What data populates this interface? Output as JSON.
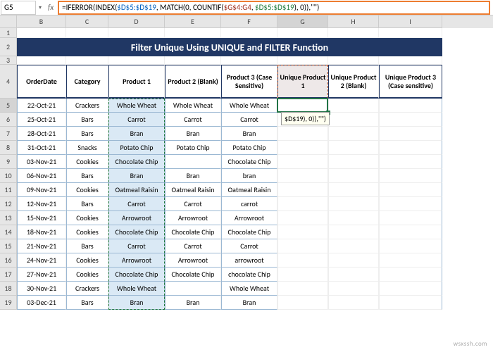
{
  "namebox": "G5",
  "fx": "fx",
  "formula_parts": {
    "p1": "=IFERROR(INDEX(",
    "p2": "$D$5:$D$19",
    "p3": ", MATCH(0, COUNTIF(",
    "p4": "$G$4:G4",
    "p5": ", ",
    "p6": "$D$5:$D$19",
    "p7": "), 0)),",
    "p8": "\"\"",
    "p9": ")"
  },
  "cols": [
    "B",
    "C",
    "D",
    "E",
    "F",
    "G",
    "H",
    "I"
  ],
  "title": "Filter Unique Using UNIQUE and FILTER Function",
  "headers": {
    "B": "OrderDate",
    "C": "Category",
    "D": "Product 1",
    "E": "Product 2 (Blank)",
    "F": "Product 3 (Case Sensitive)",
    "G": "Unique Product 1",
    "H": "Unique Product 2 (Blank)",
    "I": "Unique Product 3 (Case sensitive)"
  },
  "tooltip": "$D$19), 0)),\"\")",
  "rows": [
    {
      "n": 5,
      "B": "22-Oct-21",
      "C": "Crackers",
      "D": "Whole Wheat",
      "E": "Whole Wheat",
      "F": "Whole Wheat"
    },
    {
      "n": 6,
      "B": "25-Oct-21",
      "C": "Bars",
      "D": "Carrot",
      "E": "Carrot",
      "F": "Carrot"
    },
    {
      "n": 7,
      "B": "28-Oct-21",
      "C": "Bars",
      "D": "Bran",
      "E": "Bran",
      "F": "Bran"
    },
    {
      "n": 8,
      "B": "31-Oct-21",
      "C": "Snacks",
      "D": "Potato Chip",
      "E": "Potato Chip",
      "F": "Potato Chip"
    },
    {
      "n": 9,
      "B": "03-Nov-21",
      "C": "Cookies",
      "D": "Chocolate Chip",
      "E": "",
      "F": "Chocolate Chip"
    },
    {
      "n": 10,
      "B": "06-Nov-21",
      "C": "Bars",
      "D": "Bran",
      "E": "Bran",
      "F": "bran"
    },
    {
      "n": 11,
      "B": "09-Nov-21",
      "C": "Cookies",
      "D": "Oatmeal Raisin",
      "E": "Oatmeal Raisin",
      "F": "Oatmeal Raisin"
    },
    {
      "n": 12,
      "B": "12-Nov-21",
      "C": "Bars",
      "D": "Carrot",
      "E": "Carrot",
      "F": "carrot"
    },
    {
      "n": 13,
      "B": "15-Nov-21",
      "C": "Cookies",
      "D": "Arrowroot",
      "E": "Arrowroot",
      "F": "Arrowroot"
    },
    {
      "n": 14,
      "B": "18-Nov-21",
      "C": "Cookies",
      "D": "Chocolate Chip",
      "E": "Chocolate Chip",
      "F": "Chocolate Chip"
    },
    {
      "n": 15,
      "B": "21-Nov-21",
      "C": "Bars",
      "D": "Carrot",
      "E": "Carrot",
      "F": "Carrot"
    },
    {
      "n": 16,
      "B": "24-Nov-21",
      "C": "Cookies",
      "D": "Arrowroot",
      "E": "Arrowroot",
      "F": "arrowroot"
    },
    {
      "n": 17,
      "B": "27-Nov-21",
      "C": "Cookies",
      "D": "Chocolate Chip",
      "E": "Chocolate Chip",
      "F": "chocolate Chip"
    },
    {
      "n": 18,
      "B": "30-Nov-21",
      "C": "Crackers",
      "D": "Whole Wheat",
      "E": "",
      "F": "Whole Wheat"
    },
    {
      "n": 19,
      "B": "03-Dec-21",
      "C": "Bars",
      "D": "Bran",
      "E": "Bran",
      "F": "Bran"
    }
  ],
  "watermark": "wsxssh.com",
  "empty_rows_before": [
    "1",
    "3"
  ]
}
